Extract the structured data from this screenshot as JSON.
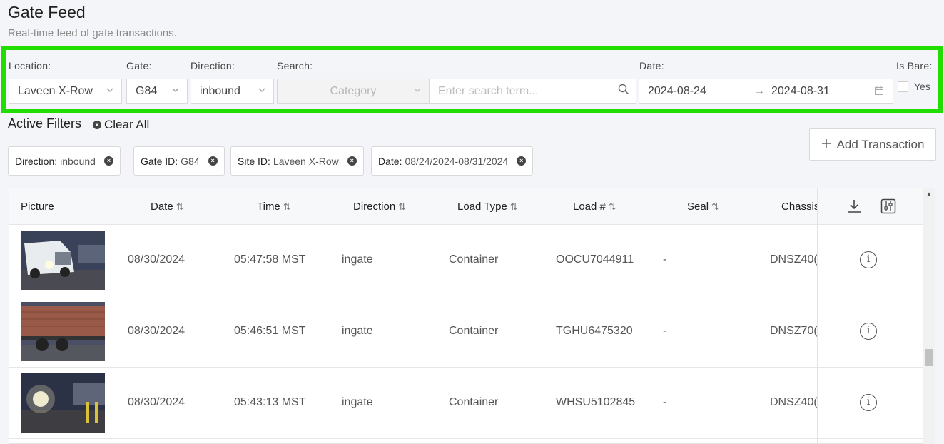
{
  "page": {
    "title": "Gate Feed",
    "subtitle": "Real-time feed of gate transactions."
  },
  "filters": {
    "location_label": "Location:",
    "location_value": "Laveen X-Row",
    "gate_label": "Gate:",
    "gate_value": "G84",
    "direction_label": "Direction:",
    "direction_value": "inbound",
    "search_label": "Search:",
    "category_placeholder": "Category",
    "search_placeholder": "Enter search term...",
    "date_label": "Date:",
    "date_start": "2024-08-24",
    "date_arrow": "→",
    "date_end": "2024-08-31",
    "is_bare_label": "Is Bare:",
    "is_bare_option": "Yes",
    "highlight_color": "#22dd00"
  },
  "active_filters": {
    "title": "Active Filters",
    "clear_all": "Clear All",
    "chips": [
      {
        "key": "Direction:",
        "value": "inbound"
      },
      {
        "key": "Gate ID:",
        "value": "G84"
      },
      {
        "key": "Site ID:",
        "value": "Laveen X-Row"
      },
      {
        "key": "Date:",
        "value": "08/24/2024-08/31/2024"
      }
    ]
  },
  "add_transaction": "Add Transaction",
  "table": {
    "headers": [
      "Picture",
      "Date",
      "Time",
      "Direction",
      "Load Type",
      "Load #",
      "Seal",
      "Chassis"
    ],
    "rows": [
      {
        "date": "08/30/2024",
        "time": "05:47:58 MST",
        "direction": "ingate",
        "load_type": "Container",
        "load_no": "OOCU7044911",
        "seal": "-",
        "chassis": "DNSZ40("
      },
      {
        "date": "08/30/2024",
        "time": "05:46:51 MST",
        "direction": "ingate",
        "load_type": "Container",
        "load_no": "TGHU6475320",
        "seal": "-",
        "chassis": "DNSZ70("
      },
      {
        "date": "08/30/2024",
        "time": "05:43:13 MST",
        "direction": "ingate",
        "load_type": "Container",
        "load_no": "WHSU5102845",
        "seal": "-",
        "chassis": "DNSZ40("
      }
    ]
  },
  "icons": {
    "download": "download-icon",
    "columns": "column-settings-icon",
    "info": "info-icon",
    "search": "search-icon",
    "calendar": "calendar-icon"
  }
}
